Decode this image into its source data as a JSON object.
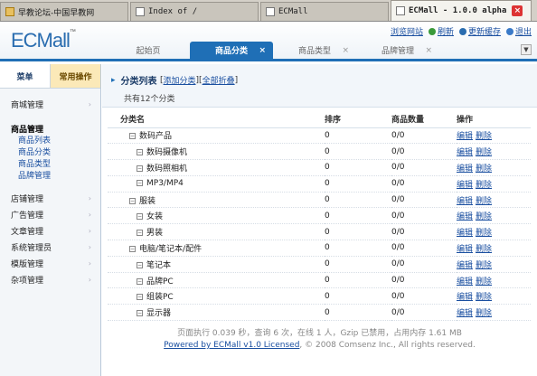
{
  "browser": {
    "tabs": [
      {
        "title": "早教论坛-中国早教网",
        "active": false
      },
      {
        "title": "Index of /",
        "active": false
      },
      {
        "title": "ECMall",
        "active": false
      },
      {
        "title": "ECMall - 1.0.0 alpha",
        "active": true
      }
    ]
  },
  "header": {
    "logo": "ECMall",
    "logo_tm": "™",
    "links": [
      "浏览网站",
      "刷新",
      "更新缓存",
      "退出"
    ],
    "tabs": [
      {
        "label": "起始页",
        "active": false,
        "closable": false
      },
      {
        "label": "商品分类",
        "active": true,
        "closable": true
      },
      {
        "label": "商品类型",
        "active": false,
        "closable": true
      },
      {
        "label": "品牌管理",
        "active": false,
        "closable": true
      }
    ],
    "tab_close_glyph": "×"
  },
  "sidebar": {
    "tabs": [
      "菜单",
      "常用操作"
    ],
    "groups_top": [
      {
        "label": "商城管理"
      }
    ],
    "open_group": {
      "label": "商品管理",
      "items": [
        "商品列表",
        "商品分类",
        "商品类型",
        "品牌管理"
      ]
    },
    "groups_bottom": [
      {
        "label": "店铺管理"
      },
      {
        "label": "广告管理"
      },
      {
        "label": "文章管理"
      },
      {
        "label": "系统管理员"
      },
      {
        "label": "模版管理"
      },
      {
        "label": "杂项管理"
      }
    ]
  },
  "content": {
    "title": "分类列表",
    "add_link": "添加分类",
    "collapse_link": "全部折叠",
    "subtitle": "共有12个分类",
    "columns": [
      "分类名",
      "排序",
      "商品数量",
      "操作"
    ],
    "rows": [
      {
        "name": "数码产品",
        "level": 0,
        "order": "0",
        "qty": "0/0"
      },
      {
        "name": "数码摄像机",
        "level": 1,
        "order": "0",
        "qty": "0/0"
      },
      {
        "name": "数码照相机",
        "level": 1,
        "order": "0",
        "qty": "0/0"
      },
      {
        "name": "MP3/MP4",
        "level": 1,
        "order": "0",
        "qty": "0/0"
      },
      {
        "name": "服装",
        "level": 0,
        "order": "0",
        "qty": "0/0"
      },
      {
        "name": "女装",
        "level": 1,
        "order": "0",
        "qty": "0/0"
      },
      {
        "name": "男装",
        "level": 1,
        "order": "0",
        "qty": "0/0"
      },
      {
        "name": "电脑/笔记本/配件",
        "level": 0,
        "order": "0",
        "qty": "0/0"
      },
      {
        "name": "笔记本",
        "level": 1,
        "order": "0",
        "qty": "0/0"
      },
      {
        "name": "品牌PC",
        "level": 1,
        "order": "0",
        "qty": "0/0"
      },
      {
        "name": "组装PC",
        "level": 1,
        "order": "0",
        "qty": "0/0"
      },
      {
        "name": "显示器",
        "level": 1,
        "order": "0",
        "qty": "0/0"
      }
    ],
    "edit_label": "编辑",
    "delete_label": "删除",
    "tree_glyph": "−"
  },
  "footer": {
    "stats": "页面执行 0.039 秒，查询 6 次，在线 1 人，Gzip 已禁用，占用内存 1.61 MB",
    "powered_link": "Powered by ECMall v1.0 Licensed",
    "copyright": ", © 2008 Comsenz Inc., All rights reserved."
  },
  "colors": {
    "accent": "#1f6fb6",
    "link": "#1a4fa0",
    "sidebar_bg": "#f3f6f9",
    "quick_tab_bg": "#fbe9b8"
  }
}
